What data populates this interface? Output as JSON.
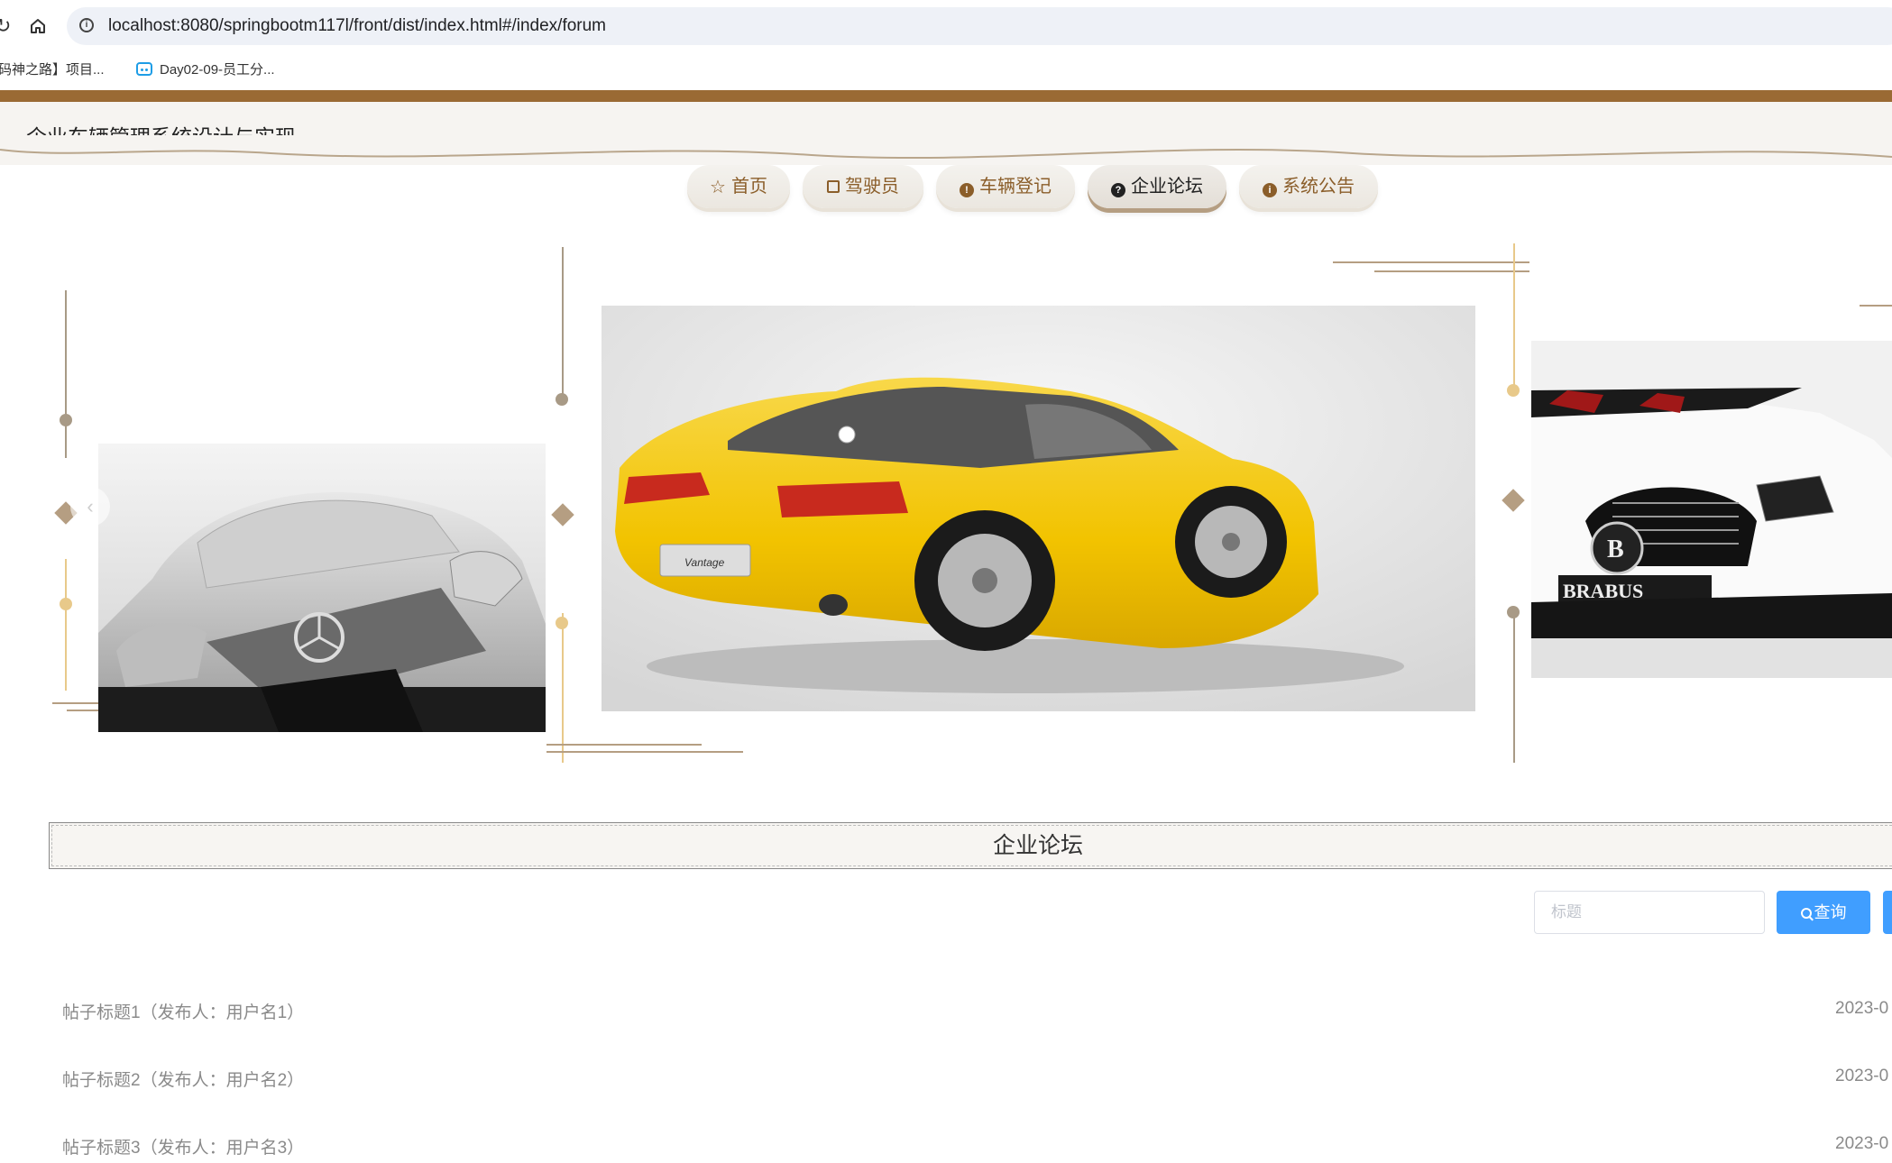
{
  "browser": {
    "url": "localhost:8080/springbootm117l/front/dist/index.html#/index/forum",
    "bookmarks": [
      {
        "label": "码神之路】项目..."
      },
      {
        "label": "Day02-09-员工分..."
      }
    ]
  },
  "site": {
    "title": "企业车辆管理系统设计与实现"
  },
  "nav": {
    "items": [
      {
        "label": "首页",
        "icon": "star-icon"
      },
      {
        "label": "驾驶员",
        "icon": "bag-icon"
      },
      {
        "label": "车辆登记",
        "icon": "exclamation-circle-icon"
      },
      {
        "label": "企业论坛",
        "icon": "question-circle-icon",
        "active": true
      },
      {
        "label": "系统公告",
        "icon": "info-circle-icon"
      }
    ]
  },
  "carousel": {
    "slides": [
      "silver-mercedes-car",
      "yellow-aston-martin-car",
      "white-brabus-convertible-car"
    ],
    "active_index": 0,
    "indicator_count": 3,
    "badges": {
      "brabus": "BRABUS",
      "vantage": "Vantage"
    }
  },
  "forum": {
    "section_title": "企业论坛",
    "search_placeholder": "标题",
    "search_button": "查询",
    "posts": [
      {
        "title": "帖子标题1（发布人：用户名1）",
        "date": "2023-0"
      },
      {
        "title": "帖子标题2（发布人：用户名2）",
        "date": "2023-0"
      },
      {
        "title": "帖子标题3（发布人：用户名3）",
        "date": "2023-0"
      }
    ]
  },
  "colors": {
    "brand_brown": "#9a6a34",
    "nav_text": "#8b5e2a",
    "primary_button": "#409eff",
    "deco_gold": "#e8c98a",
    "deco_gray": "#a89a86"
  }
}
